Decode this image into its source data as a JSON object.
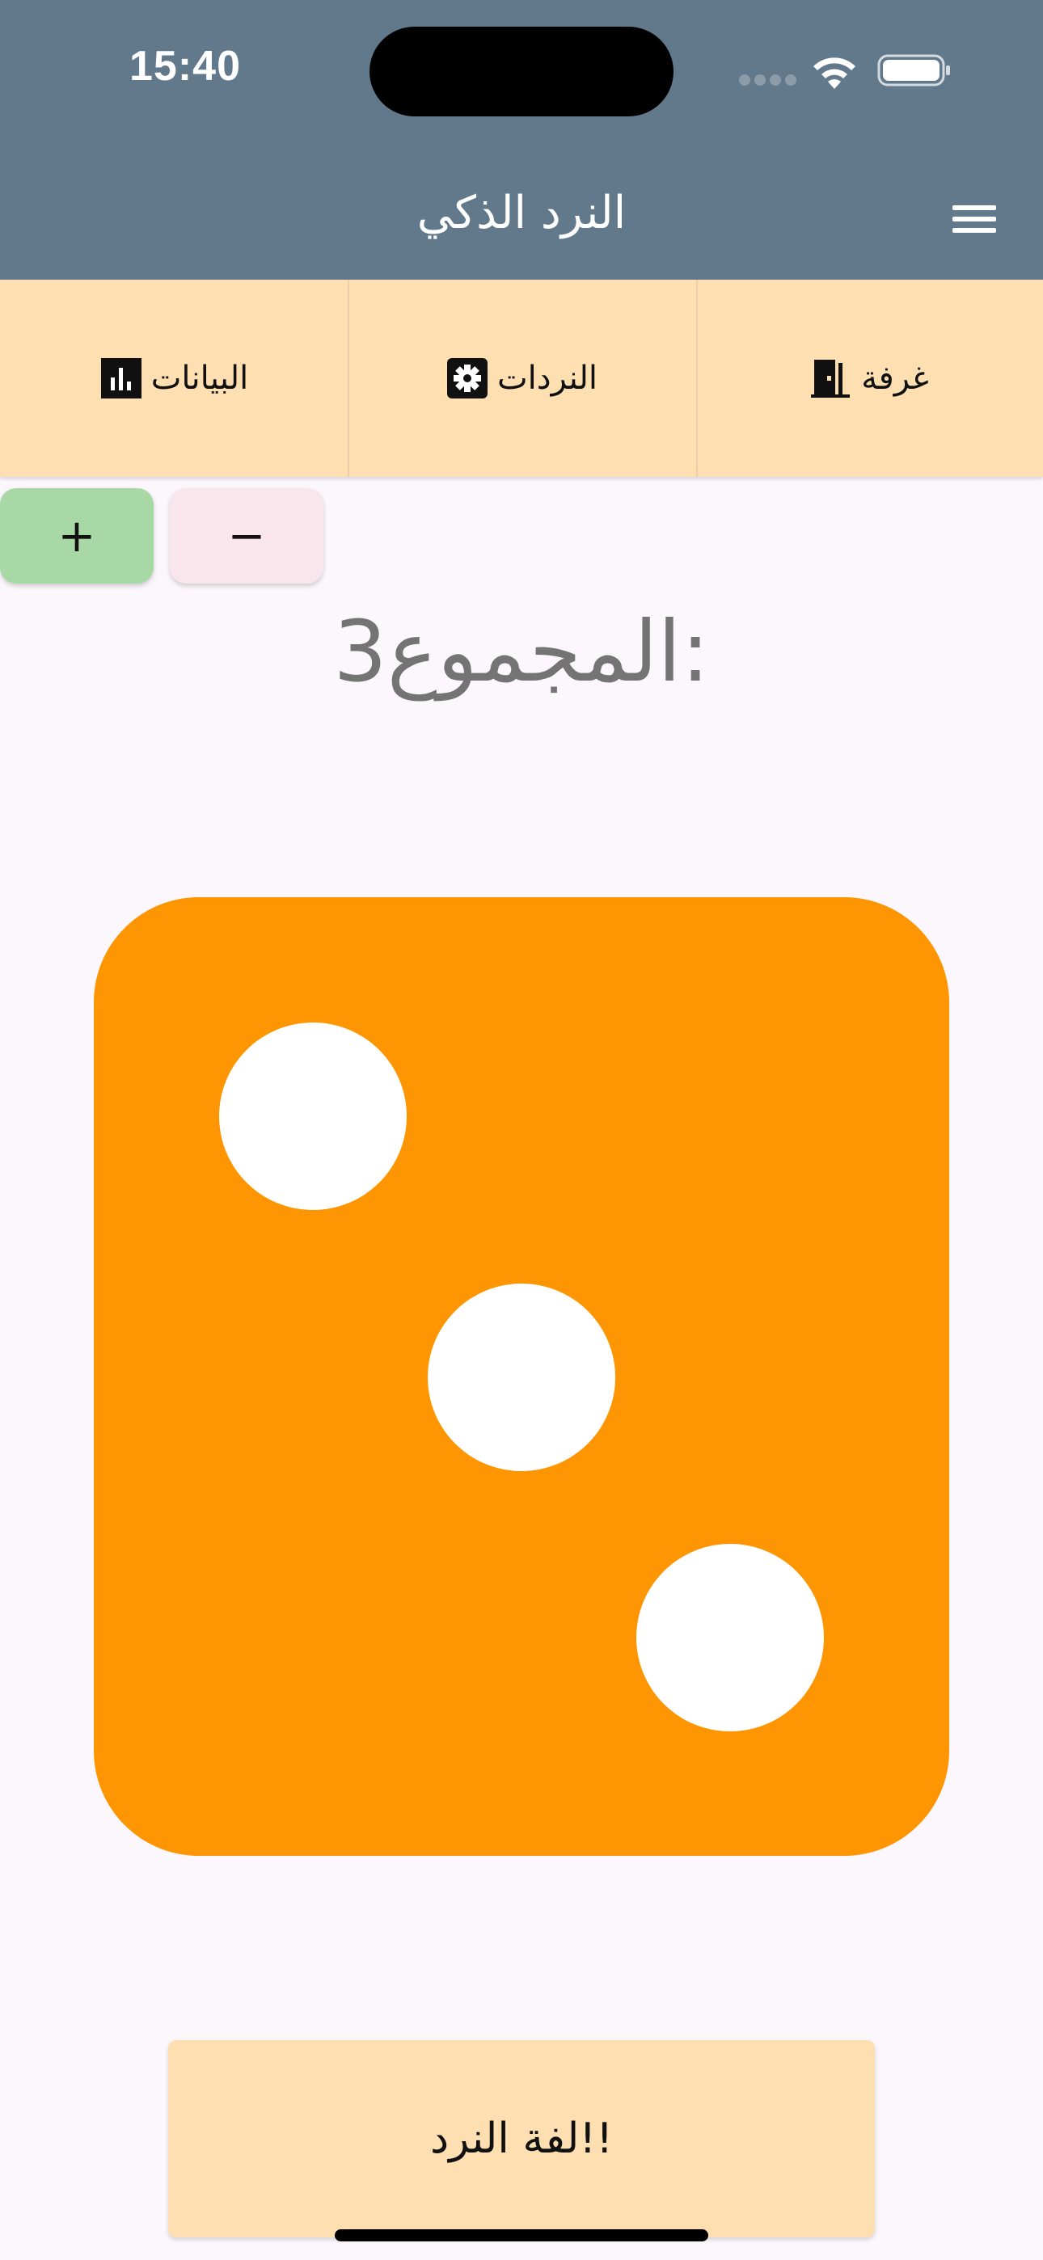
{
  "status_bar": {
    "time": "15:40",
    "icons": [
      "signal-icon",
      "wifi-icon",
      "battery-icon"
    ]
  },
  "app_bar": {
    "title": "النرد الذكي",
    "menu_icon": "hamburger-menu-icon",
    "background_color": "#62798b"
  },
  "tabs": [
    {
      "label": "غرفة",
      "icon": "door-icon"
    },
    {
      "label": "النردات",
      "icon": "settings-gear-icon"
    },
    {
      "label": "البيانات",
      "icon": "bar-chart-icon"
    }
  ],
  "tab_bar_color": "#fddfb2",
  "stepper": {
    "plus_label": "+",
    "minus_label": "−",
    "plus_color": "#a8d8a6",
    "minus_color": "#f9e6ec"
  },
  "total": {
    "label": "المجموع:",
    "value": "3"
  },
  "die": {
    "face_value": 3,
    "color": "#fd9602",
    "pip_color": "#ffffff"
  },
  "roll_button": {
    "label": "لفة النرد!!"
  }
}
